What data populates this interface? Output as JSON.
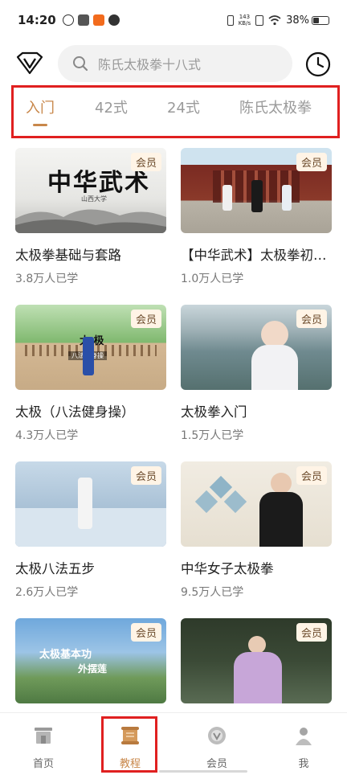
{
  "status_bar": {
    "time": "14:20",
    "net_speed_value": "143",
    "net_speed_unit": "KB/s",
    "battery": "38%",
    "battery_level": 0.38
  },
  "search": {
    "placeholder": "陈氏太极拳十八式"
  },
  "tabs": [
    {
      "label": "入门",
      "active": true
    },
    {
      "label": "42式",
      "active": false
    },
    {
      "label": "24式",
      "active": false
    },
    {
      "label": "陈氏太极拳",
      "active": false
    }
  ],
  "courses": [
    {
      "title": "太极拳基础与套路",
      "learners": "3.8万人已学",
      "badge": "会员",
      "thumb_text": "中华武术",
      "thumb_sub": "山西大学"
    },
    {
      "title": "【中华武术】太极拳初…",
      "learners": "1.0万人已学",
      "badge": "会员"
    },
    {
      "title": "太极（八法健身操）",
      "learners": "4.3万人已学",
      "badge": "会员",
      "thumb_text": "太 极",
      "thumb_sub": "八法健身操"
    },
    {
      "title": "太极拳入门",
      "learners": "1.5万人已学",
      "badge": "会员"
    },
    {
      "title": "太极八法五步",
      "learners": "2.6万人已学",
      "badge": "会员"
    },
    {
      "title": "中华女子太极拳",
      "learners": "9.5万人已学",
      "badge": "会员"
    },
    {
      "title": "",
      "learners": "",
      "badge": "会员",
      "thumb_text": "太极基本功",
      "thumb_sub": "外摆莲"
    },
    {
      "title": "",
      "learners": "",
      "badge": "会员"
    }
  ],
  "bottom_nav": [
    {
      "label": "首页",
      "icon": "home-icon",
      "active": false
    },
    {
      "label": "教程",
      "icon": "scroll-icon",
      "active": true
    },
    {
      "label": "会员",
      "icon": "vip-coin-icon",
      "active": false
    },
    {
      "label": "我",
      "icon": "profile-icon",
      "active": false
    }
  ],
  "colors": {
    "accent": "#c8874a",
    "highlight_frame": "#e02020",
    "badge_bg": "#fff4e6"
  }
}
